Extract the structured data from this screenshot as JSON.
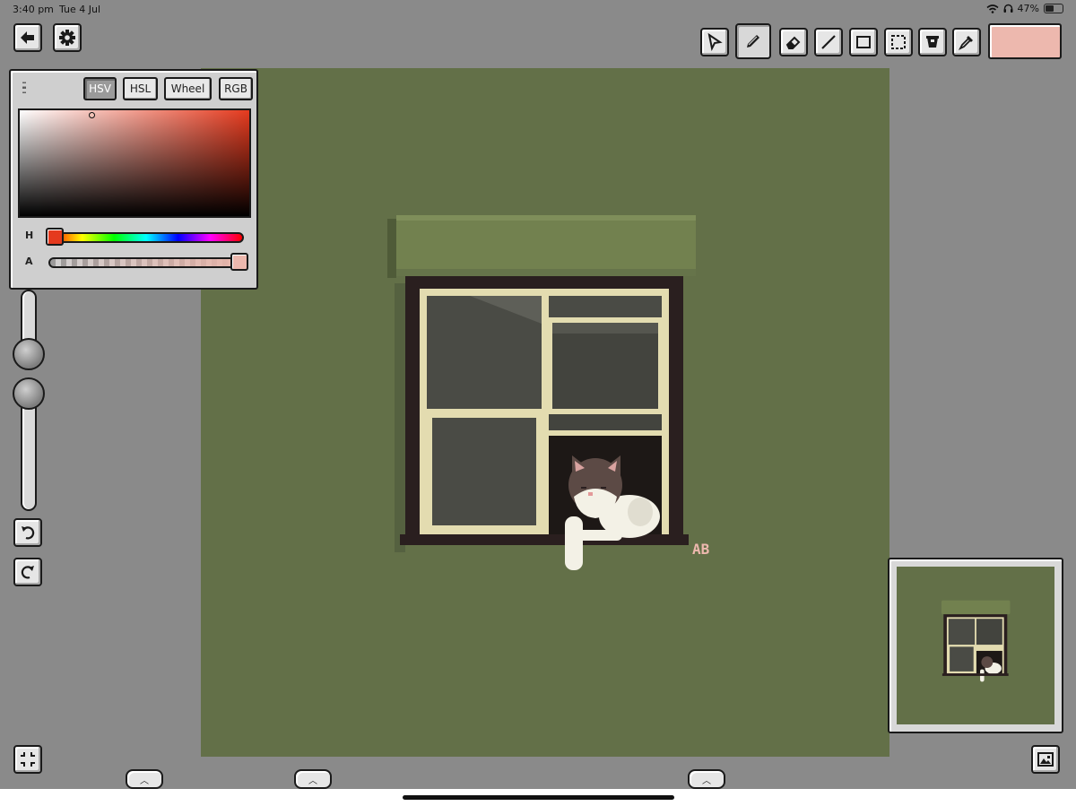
{
  "status_bar": {
    "time": "3:40 pm",
    "date": "Tue 4 Jul",
    "battery": "47%"
  },
  "top_left": {
    "back_icon": "back-arrow-icon",
    "settings_icon": "gear-icon"
  },
  "toolbar": {
    "tools": [
      {
        "name": "select",
        "icon": "select-arrow-icon"
      },
      {
        "name": "pencil",
        "icon": "pencil-icon",
        "active": true
      },
      {
        "name": "eraser",
        "icon": "eraser-icon"
      },
      {
        "name": "line",
        "icon": "line-icon"
      },
      {
        "name": "rectangle",
        "icon": "rectangle-icon"
      },
      {
        "name": "marquee",
        "icon": "marquee-icon"
      },
      {
        "name": "fill",
        "icon": "bucket-icon"
      },
      {
        "name": "eyedropper",
        "icon": "eyedropper-icon"
      }
    ],
    "current_color": "#edb8ae"
  },
  "color_panel": {
    "modes": [
      "HSV",
      "HSL",
      "Wheel",
      "RGB"
    ],
    "active_mode": "HSV",
    "hue_label": "H",
    "alpha_label": "A",
    "hue_color": "#e53a1e",
    "alpha": 1.0
  },
  "canvas": {
    "background": "#637048",
    "signature": "AB"
  },
  "colors": {
    "canvas_green": "#637048",
    "awning_green": "#72814f",
    "frame_dark": "#2a1f1f",
    "sash_cream": "#e3dcb0",
    "glass": "#4a4b45"
  }
}
